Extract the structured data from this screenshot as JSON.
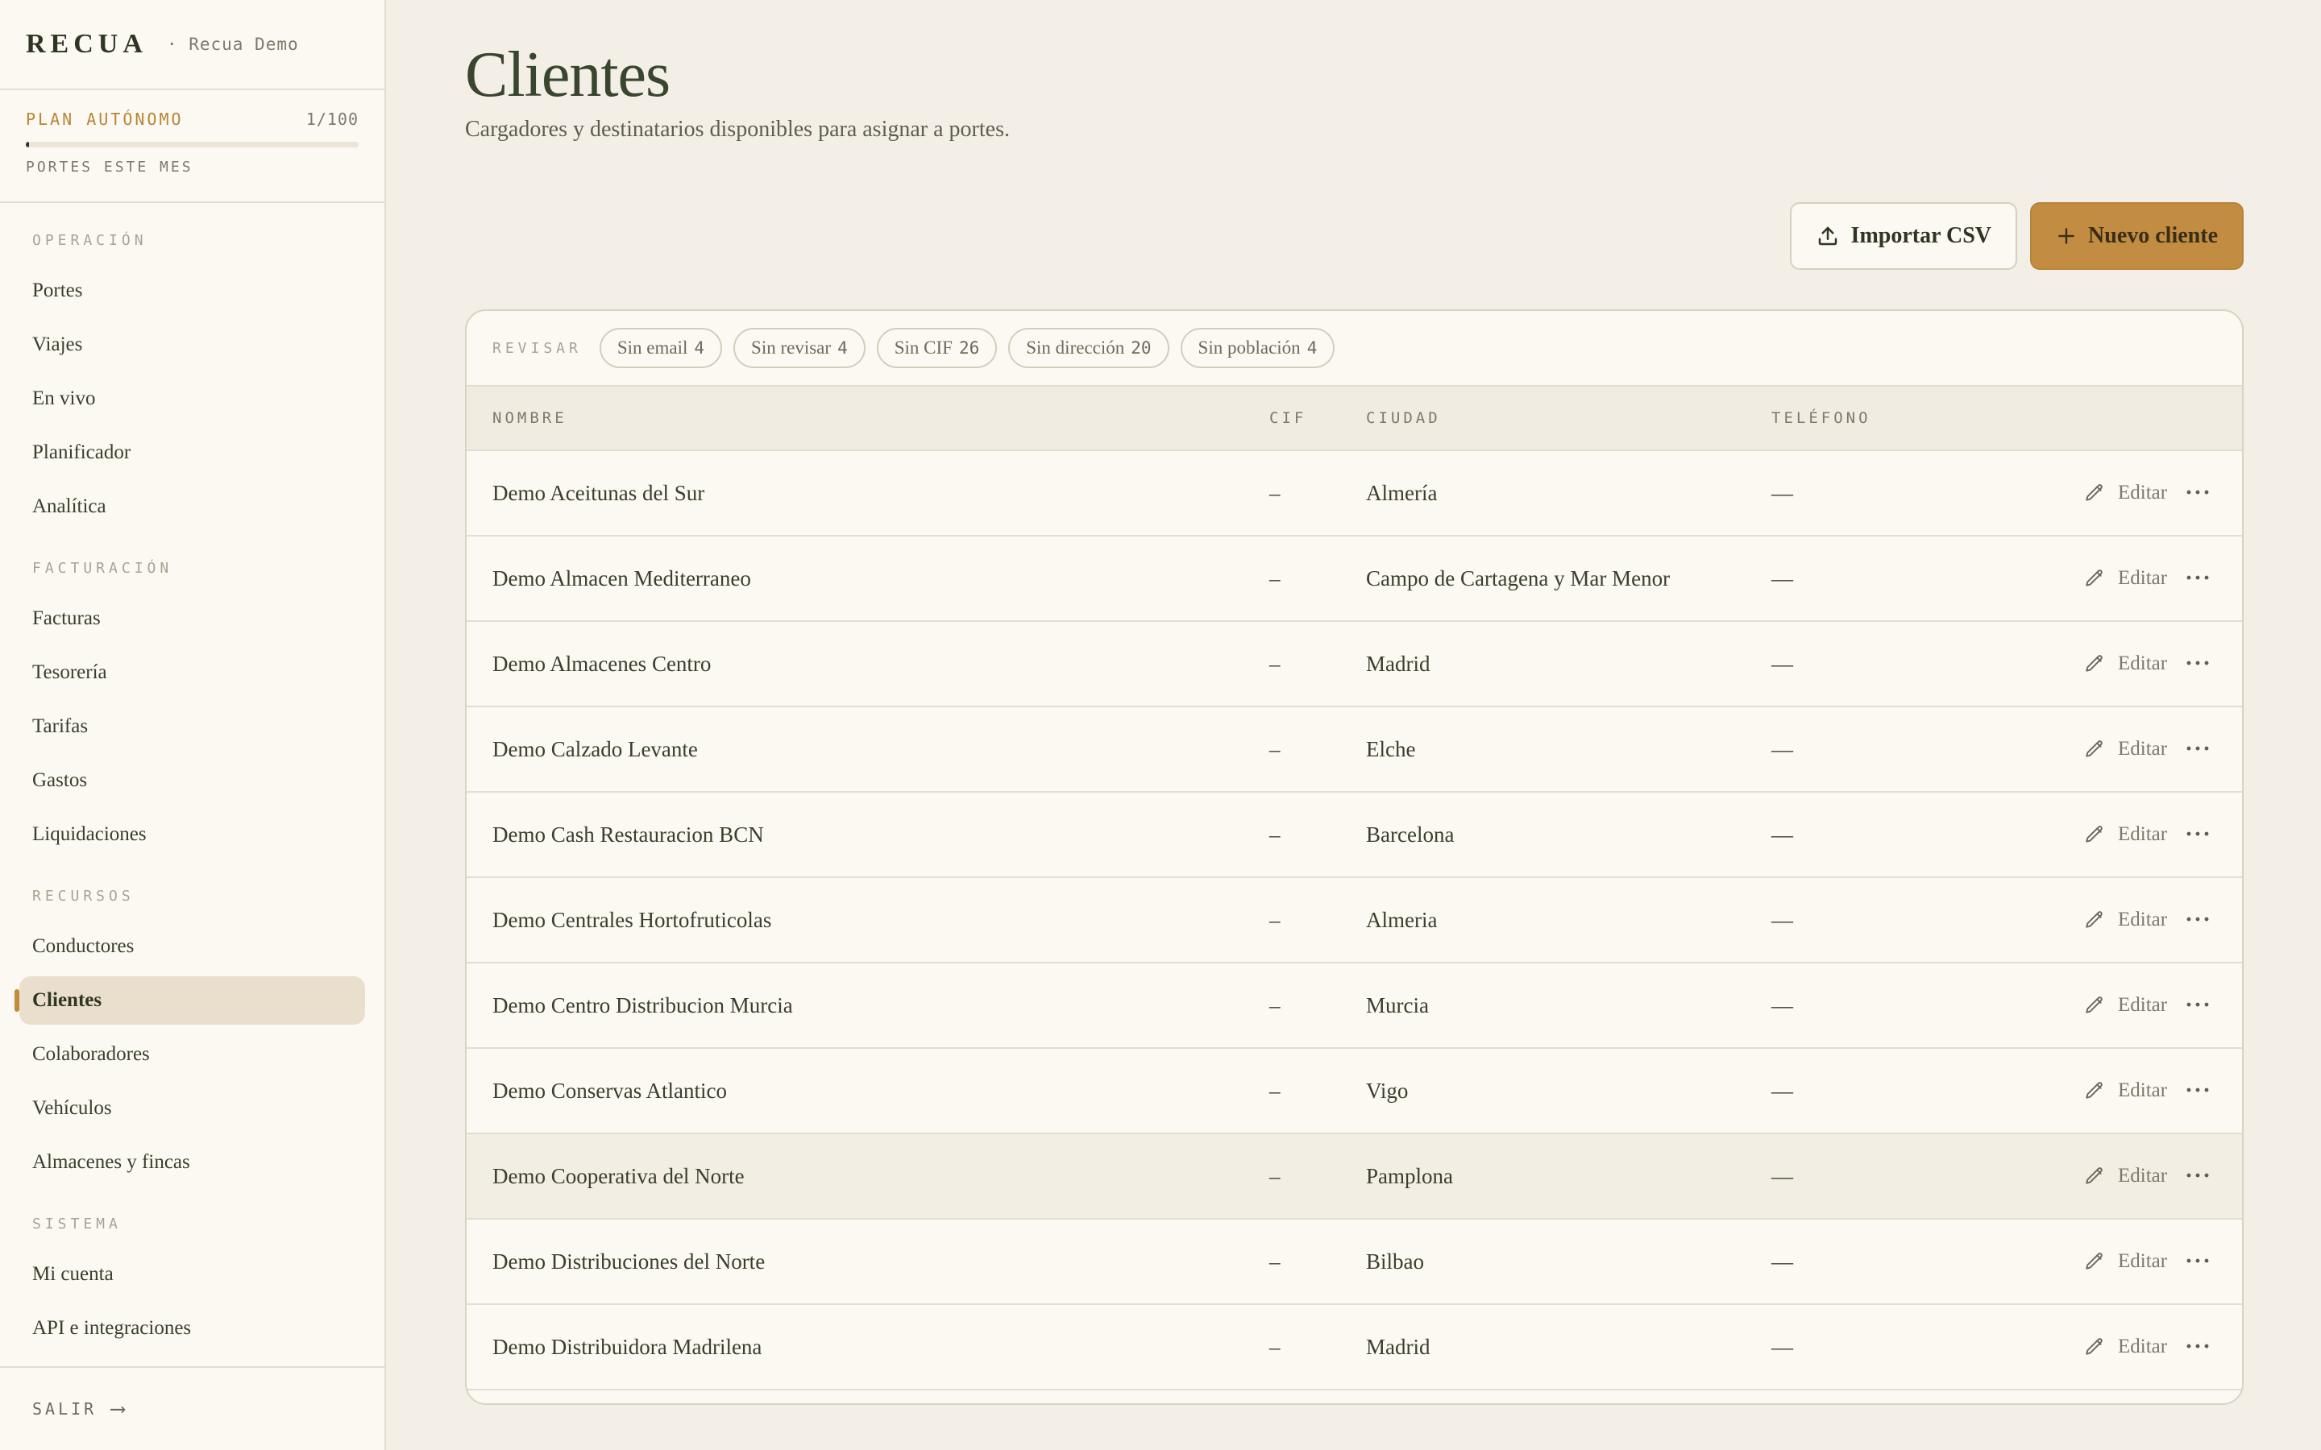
{
  "brand": {
    "logo": "RECUA",
    "subtitle": "· Recua Demo"
  },
  "plan": {
    "name": "PLAN AUTÓNOMO",
    "count": "1/100",
    "label": "PORTES ESTE MES",
    "progress_fraction": 0.01
  },
  "nav": {
    "sections": [
      {
        "heading": "OPERACIÓN",
        "items": [
          "Portes",
          "Viajes",
          "En vivo",
          "Planificador",
          "Analítica"
        ]
      },
      {
        "heading": "FACTURACIÓN",
        "items": [
          "Facturas",
          "Tesorería",
          "Tarifas",
          "Gastos",
          "Liquidaciones"
        ]
      },
      {
        "heading": "RECURSOS",
        "items": [
          "Conductores",
          "Clientes",
          "Colaboradores",
          "Vehículos",
          "Almacenes y fincas"
        ]
      },
      {
        "heading": "SISTEMA",
        "items": [
          "Mi cuenta",
          "API e integraciones"
        ]
      }
    ],
    "active": "Clientes",
    "logout": "SALIR",
    "logout_arrow": "⟶"
  },
  "page": {
    "title": "Clientes",
    "subtitle": "Cargadores y destinatarios disponibles para asignar a portes."
  },
  "actions": {
    "import_label": "Importar CSV",
    "new_label": "Nuevo cliente"
  },
  "filters": {
    "label": "REVISAR",
    "chips": [
      {
        "label": "Sin email",
        "count": "4"
      },
      {
        "label": "Sin revisar",
        "count": "4"
      },
      {
        "label": "Sin CIF",
        "count": "26"
      },
      {
        "label": "Sin dirección",
        "count": "20"
      },
      {
        "label": "Sin población",
        "count": "4"
      }
    ]
  },
  "table": {
    "headers": {
      "name": "NOMBRE",
      "cif": "CIF",
      "city": "CIUDAD",
      "phone": "TELÉFONO"
    },
    "edit_label": "Editar",
    "more_label": "···",
    "rows": [
      {
        "name": "Demo Aceitunas del Sur",
        "cif": "–",
        "city": "Almería",
        "phone": "—"
      },
      {
        "name": "Demo Almacen Mediterraneo",
        "cif": "–",
        "city": "Campo de Cartagena y Mar Menor",
        "phone": "—"
      },
      {
        "name": "Demo Almacenes Centro",
        "cif": "–",
        "city": "Madrid",
        "phone": "—"
      },
      {
        "name": "Demo Calzado Levante",
        "cif": "–",
        "city": "Elche",
        "phone": "—"
      },
      {
        "name": "Demo Cash Restauracion BCN",
        "cif": "–",
        "city": "Barcelona",
        "phone": "—"
      },
      {
        "name": "Demo Centrales Hortofruticolas",
        "cif": "–",
        "city": "Almeria",
        "phone": "—"
      },
      {
        "name": "Demo Centro Distribucion Murcia",
        "cif": "–",
        "city": "Murcia",
        "phone": "—"
      },
      {
        "name": "Demo Conservas Atlantico",
        "cif": "–",
        "city": "Vigo",
        "phone": "—"
      },
      {
        "name": "Demo Cooperativa del Norte",
        "cif": "–",
        "city": "Pamplona",
        "phone": "—"
      },
      {
        "name": "Demo Distribuciones del Norte",
        "cif": "–",
        "city": "Bilbao",
        "phone": "—"
      },
      {
        "name": "Demo Distribuidora Madrilena",
        "cif": "–",
        "city": "Madrid",
        "phone": "—"
      }
    ],
    "highlighted_row": 8
  },
  "colors": {
    "accent": "#c28d42",
    "background": "#f3efe7",
    "sidebar": "#fbf9f2",
    "text": "#3a3f2c"
  }
}
